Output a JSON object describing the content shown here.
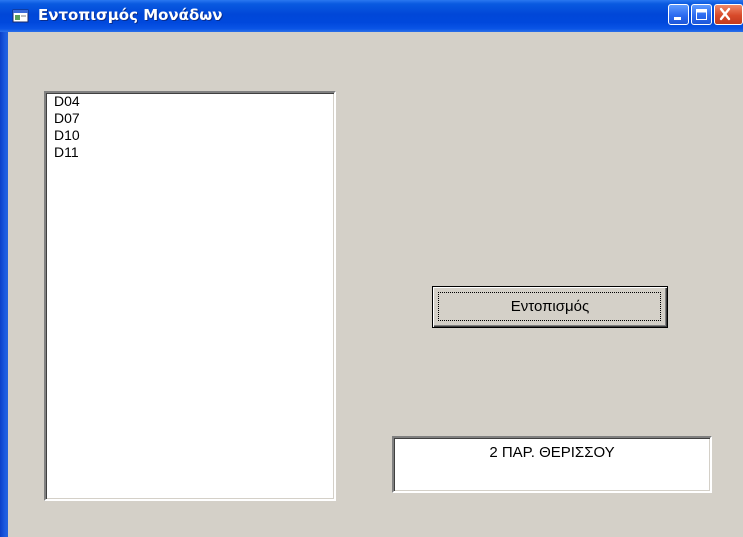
{
  "window": {
    "title": "Εντοπισμός Μονάδων",
    "title_color": "#ffffff",
    "titlebar_color": "#0047d8",
    "background_color": "#d4d0c8",
    "controls": {
      "minimize_icon": "minimize-icon",
      "maximize_icon": "maximize-icon",
      "close_icon": "close-icon"
    }
  },
  "unit_list": {
    "items": [
      "D04",
      "D07",
      "D10",
      "D11"
    ]
  },
  "locate_button": {
    "label": "Εντοπισμός"
  },
  "result_field": {
    "value": "2 ΠΑΡ. ΘΕΡΙΣΣΟΥ"
  }
}
